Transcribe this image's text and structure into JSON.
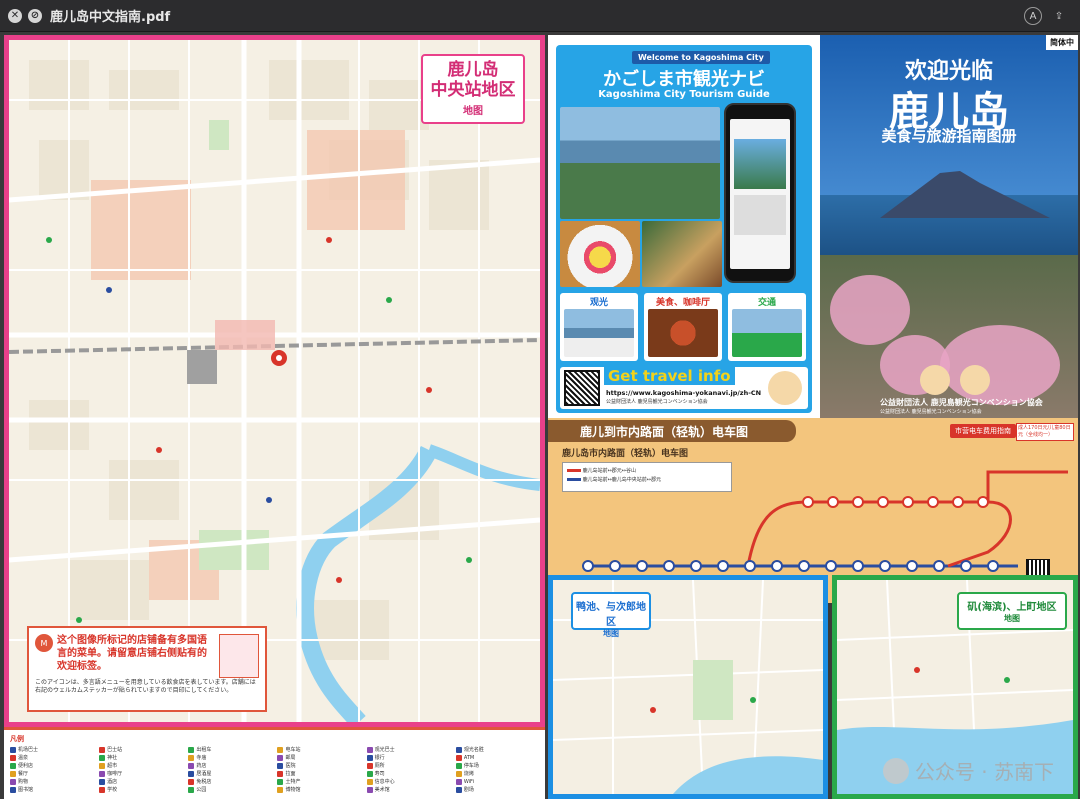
{
  "window": {
    "title": "鹿儿岛中文指南.pdf",
    "left_icons": [
      "close-circle-icon",
      "slash-circle-icon"
    ],
    "right_icons": [
      "markup-icon",
      "share-icon"
    ]
  },
  "left_map": {
    "area_label_line1": "鹿儿岛",
    "area_label_line2": "中央站地区",
    "area_label_sub": "地图",
    "notice_text": "这个图像所标记的店铺备有多国语言的菜单。请留意店铺右侧贴有的欢迎标签。",
    "notice_jp": "このアイコンは、多言語メニューを用意している飲食店を表しています。店舗には右記のウェルカムステッカーが貼られていますので目印にしてください。"
  },
  "legend": {
    "title": "凡例",
    "items": [
      "机场巴士",
      "巴士站",
      "出租车",
      "电车站",
      "观光巴士",
      "观光名胜",
      "温泉",
      "神社",
      "寺庙",
      "邮局",
      "银行",
      "ATM",
      "便利店",
      "超市",
      "药店",
      "医院",
      "厕所",
      "停车场",
      "餐厅",
      "咖啡厅",
      "居酒屋",
      "拉面",
      "寿司",
      "烧烤",
      "购物",
      "酒店",
      "免税店",
      "土特产",
      "信息中心",
      "WiFi",
      "图书馆",
      "学校",
      "公园",
      "博物馆",
      "美术馆",
      "剧场"
    ]
  },
  "brochure": {
    "welcome": "Welcome to Kagoshima City",
    "title_jp": "かごしま市観光ナビ",
    "title_en": "Kagoshima City Tourism Guide",
    "categories": [
      {
        "label": "观光",
        "color": "#1c6fd0"
      },
      {
        "label": "美食、咖啡厅",
        "color": "#d8352a"
      },
      {
        "label": "交通",
        "color": "#2aa84a"
      }
    ],
    "cta": "Get travel info",
    "url": "https://www.kagoshima-yokanavi.jp/zh-CN",
    "footer": "公益財団法人 鹿児島観光コンベンション協会"
  },
  "cover": {
    "badge": "简体中",
    "line1": "欢迎光临",
    "line2": "鹿儿岛",
    "line3": "美食与旅游指南图册",
    "org": "公益財団法人 鹿児島観光コンベンション協会",
    "org_sub": "公益財団法人 鹿児島観光コンベンション協会"
  },
  "tram": {
    "title": "鹿儿到市内路面（轻轨）电车图",
    "subtitle": "鹿儿岛市内路面（轻轨）电车图",
    "fare_button": "市营电车费用指南",
    "fare_note": "成人170日元/儿童80日元（全线均一）",
    "routes": [
      {
        "name": "鹿儿岛站前↔郡元↔谷山",
        "color": "#d8352a"
      },
      {
        "name": "鹿儿岛站前↔鹿儿岛中央站前↔郡元",
        "color": "#2a4da0"
      }
    ]
  },
  "bottom_maps": [
    {
      "label_line1": "鸭池、与次郎地区",
      "label_sub": "地图",
      "color": "#1c8fe3"
    },
    {
      "label_line1": "矶(海滨)、上町地区",
      "label_sub": "地图",
      "color": "#2aa84a"
    }
  ],
  "watermark": "公众号 · 苏南下"
}
